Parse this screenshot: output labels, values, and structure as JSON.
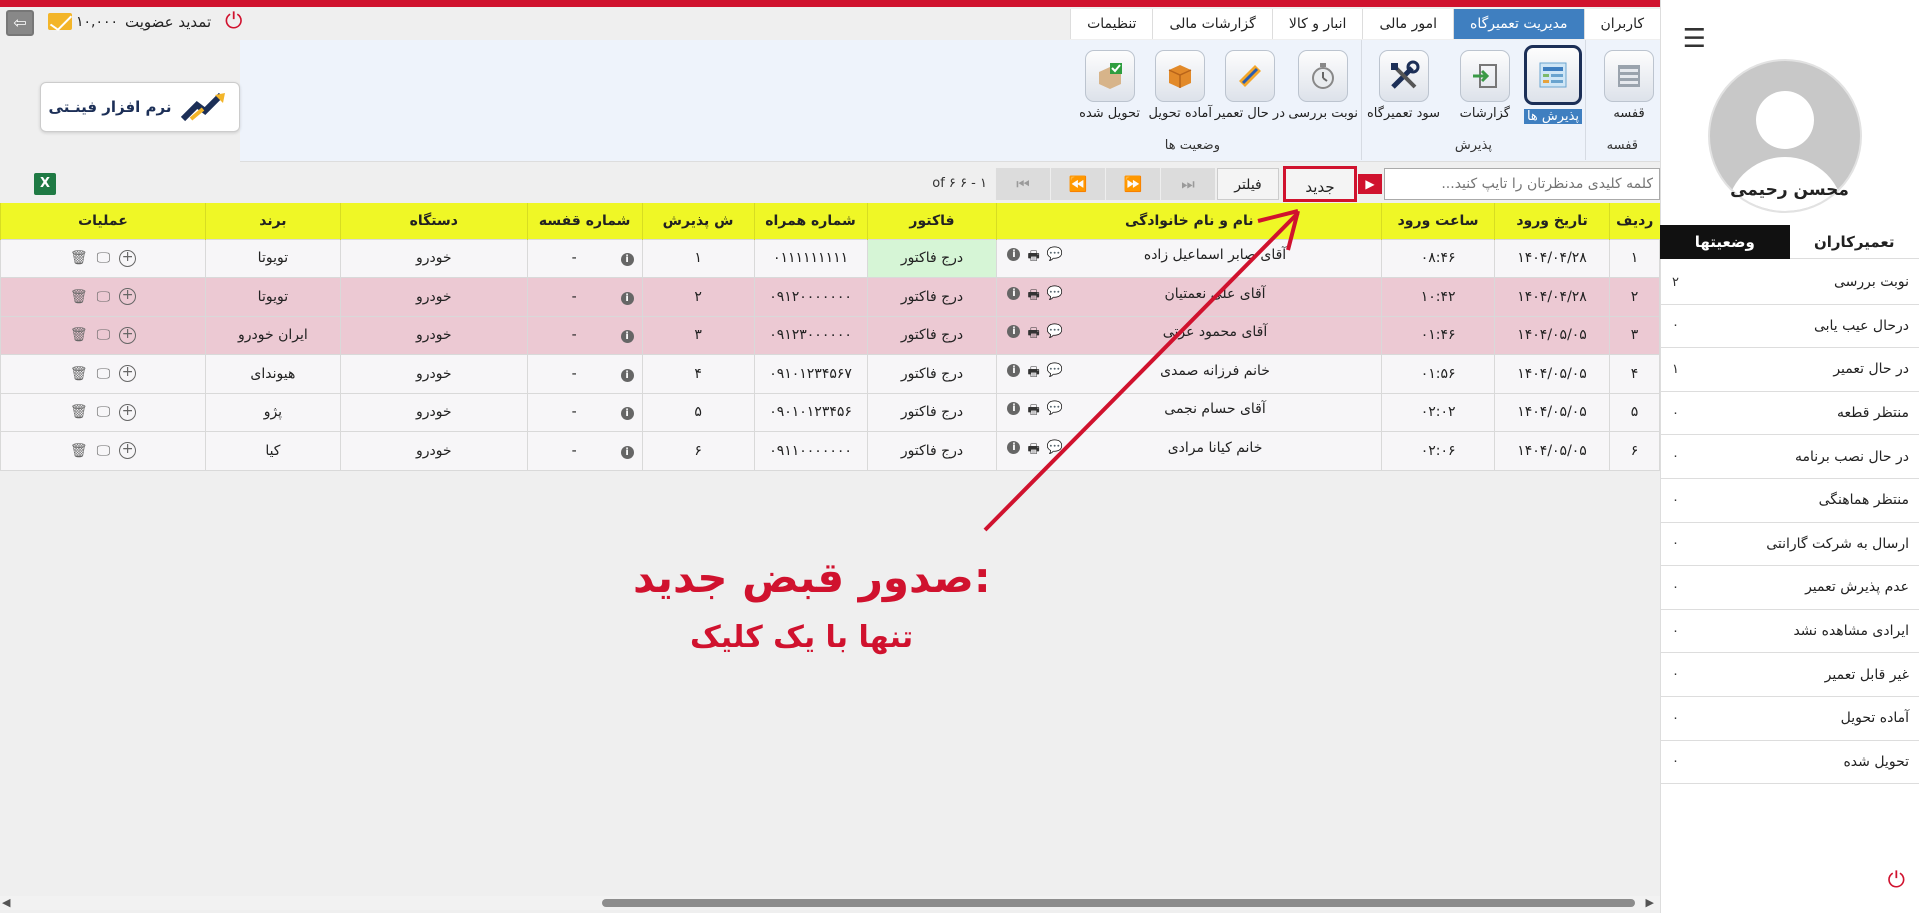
{
  "sidebar": {
    "user_name": "محسن رحیمی",
    "tabs": [
      {
        "label": "تعمیرکاران"
      },
      {
        "label": "وضعیتها"
      }
    ],
    "statuses": [
      {
        "label": "نوبت بررسی",
        "count": "۲"
      },
      {
        "label": "درحال عیب یابی",
        "count": "۰"
      },
      {
        "label": "در حال تعمیر",
        "count": "۱"
      },
      {
        "label": "منتظر قطعه",
        "count": "۰"
      },
      {
        "label": "در حال نصب برنامه",
        "count": "۰"
      },
      {
        "label": "منتظر هماهنگی",
        "count": "۰"
      },
      {
        "label": "ارسال به شرکت گارانتی",
        "count": "۰"
      },
      {
        "label": "عدم پذیرش تعمیر",
        "count": "۰"
      },
      {
        "label": "ایرادی مشاهده نشد",
        "count": "۰"
      },
      {
        "label": "غیر قابل تعمیر",
        "count": "۰"
      },
      {
        "label": "آماده تحویل",
        "count": "۰"
      },
      {
        "label": "تحویل شده",
        "count": "۰"
      }
    ]
  },
  "nav": {
    "tabs": [
      {
        "label": "کاربران"
      },
      {
        "label": "مدیریت تعمیرگاه"
      },
      {
        "label": "امور مالی"
      },
      {
        "label": "انبار و کالا"
      },
      {
        "label": "گزارشات مالی"
      },
      {
        "label": "تنظیمات"
      }
    ]
  },
  "topbar": {
    "credit": "۱۰,۰۰۰",
    "renew_label": "تمدید عضویت"
  },
  "ribbon": {
    "buttons": {
      "cage": "قفسه",
      "receptions": "پذیرش ها",
      "reports": "گزارشات",
      "profit": "سود تعمیرگاه",
      "queue": "نوبت بررسی",
      "repairing": "در حال تعمیر",
      "ready": "آماده تحویل",
      "delivered": "تحویل شده"
    },
    "groups": {
      "cage": "قفسه",
      "reception": "پذیرش",
      "statuses": "وضعیت ها"
    }
  },
  "logo": {
    "text": "نرم افزار فینـتی"
  },
  "toolbar": {
    "search_placeholder": "کلمه کلیدی مدنظرتان را تایپ کنید...",
    "new_label": "جدید",
    "filter_label": "فیلتر",
    "page_info": "۱ - ۶ of ۶"
  },
  "table": {
    "headers": {
      "row": "ردیف",
      "date": "تاریخ ورود",
      "time": "ساعت ورود",
      "name": "نام و نام خانوادگی",
      "invoice": "فاکتور",
      "phone": "شماره همراه",
      "reception_no": "ش پذیرش",
      "cage_no": "شماره قفسه",
      "device": "دستگاه",
      "brand": "برند",
      "ops": "عملیات"
    },
    "rows": [
      {
        "row": "۱",
        "date": "۱۴۰۴/۰۴/۲۸",
        "time": "۰۸:۴۶",
        "name": "آقای صابر اسماعیل زاده",
        "invoice": "درج فاکتور",
        "phone": "۰۱۱۱۱۱۱۱۱۱",
        "reception_no": "۱",
        "cage_no": "-",
        "device": "خودرو",
        "brand": "تویوتا"
      },
      {
        "row": "۲",
        "date": "۱۴۰۴/۰۴/۲۸",
        "time": "۱۰:۴۲",
        "name": "آقای علی نعمتیان",
        "invoice": "درج فاکتور",
        "phone": "۰۹۱۲۰۰۰۰۰۰۰",
        "reception_no": "۲",
        "cage_no": "-",
        "device": "خودرو",
        "brand": "تویوتا"
      },
      {
        "row": "۳",
        "date": "۱۴۰۴/۰۵/۰۵",
        "time": "۰۱:۴۶",
        "name": "آقای محمود عزتی",
        "invoice": "درج فاکتور",
        "phone": "۰۹۱۲۳۰۰۰۰۰۰",
        "reception_no": "۳",
        "cage_no": "-",
        "device": "خودرو",
        "brand": "ایران خودرو"
      },
      {
        "row": "۴",
        "date": "۱۴۰۴/۰۵/۰۵",
        "time": "۰۱:۵۶",
        "name": "خانم فرزانه صمدی",
        "invoice": "درج فاکتور",
        "phone": "۰۹۱۰۱۲۳۴۵۶۷",
        "reception_no": "۴",
        "cage_no": "-",
        "device": "خودرو",
        "brand": "هیوندای"
      },
      {
        "row": "۵",
        "date": "۱۴۰۴/۰۵/۰۵",
        "time": "۰۲:۰۲",
        "name": "آقای حسام نجمی",
        "invoice": "درج فاکتور",
        "phone": "۰۹۰۱۰۱۲۳۴۵۶",
        "reception_no": "۵",
        "cage_no": "-",
        "device": "خودرو",
        "brand": "پژو"
      },
      {
        "row": "۶",
        "date": "۱۴۰۴/۰۵/۰۵",
        "time": "۰۲:۰۶",
        "name": "خانم کیانا مرادی",
        "invoice": "درج فاکتور",
        "phone": "۰۹۱۱۰۰۰۰۰۰۰",
        "reception_no": "۶",
        "cage_no": "-",
        "device": "خودرو",
        "brand": "کیا"
      }
    ]
  },
  "annotation": {
    "title": "صدور قبض جدید:",
    "subtitle": "تنها با یک کلیک"
  },
  "colors": {
    "brand_red": "#d0122e",
    "nav_active": "#3f7fc0",
    "header_yellow": "#eff726",
    "row_pink": "#ecc9d3",
    "invoice_green": "#d6f5d6"
  }
}
